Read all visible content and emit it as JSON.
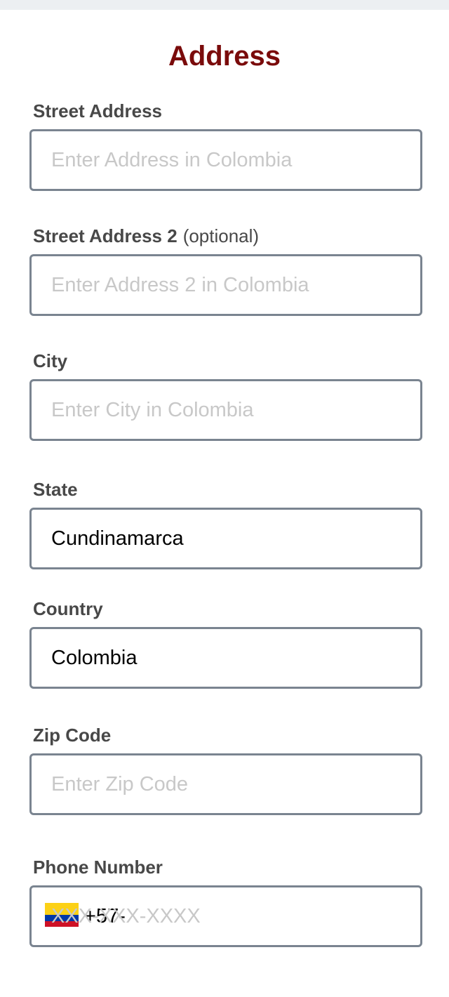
{
  "form": {
    "title": "Address",
    "street_address": {
      "label": "Street Address",
      "placeholder": "Enter Address in Colombia",
      "value": ""
    },
    "street_address_2": {
      "label": "Street Address 2",
      "optional_note": "(optional)",
      "placeholder": "Enter Address 2 in Colombia",
      "value": ""
    },
    "city": {
      "label": "City",
      "placeholder": "Enter City in Colombia",
      "value": ""
    },
    "state": {
      "label": "State",
      "value": "Cundinamarca"
    },
    "country": {
      "label": "Country",
      "value": "Colombia"
    },
    "zip_code": {
      "label": "Zip Code",
      "placeholder": "Enter Zip Code",
      "value": ""
    },
    "phone_number": {
      "label": "Phone Number",
      "flag_icon": "colombia-flag-icon",
      "country_code": "+57-",
      "placeholder": "XXX-XXX-XXXX",
      "value": ""
    }
  },
  "colors": {
    "title": "#7a0b0b",
    "label": "#484848",
    "field_border": "#7a8490",
    "placeholder": "#c8c8c8",
    "top_strip": "#eceff2"
  }
}
